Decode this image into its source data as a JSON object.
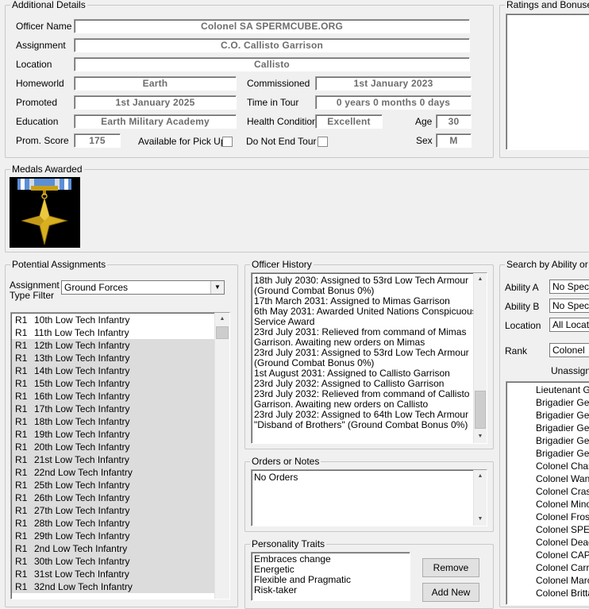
{
  "additional_details": {
    "title": "Additional Details",
    "officer_name_label": "Officer Name",
    "officer_name": "Colonel SA SPERMCUBE.ORG",
    "assignment_label": "Assignment",
    "assignment": "C.O. Callisto Garrison",
    "location_label": "Location",
    "location": "Callisto",
    "homeworld_label": "Homeworld",
    "homeworld": "Earth",
    "commissioned_label": "Commissioned",
    "commissioned": "1st January 2023",
    "promoted_label": "Promoted",
    "promoted": "1st January 2025",
    "time_in_tour_label": "Time in Tour",
    "time_in_tour": "0 years 0 months 0 days",
    "education_label": "Education",
    "education": "Earth Military Academy",
    "health_label": "Health Condition",
    "health": "Excellent",
    "age_label": "Age",
    "age": "30",
    "prom_score_label": "Prom. Score",
    "prom_score": "175",
    "pickup_label": "Available for Pick Up",
    "not_end_tour_label": "Do Not End Tour",
    "sex_label": "Sex",
    "sex": "M"
  },
  "ratings": {
    "title": "Ratings and Bonuses"
  },
  "medals": {
    "title": "Medals Awarded"
  },
  "colors": {
    "ribbon_blue": "#5b8fd6",
    "medal_gold": "#d8b020"
  },
  "potential_assignments": {
    "title": "Potential Assignments",
    "filter_label_1": "Assignment",
    "filter_label_2": "Type Filter",
    "filter_value": "Ground Forces",
    "items": [
      {
        "r": "R1",
        "name": "10th Low Tech Infantry"
      },
      {
        "r": "R1",
        "name": "11th Low Tech Infantry"
      },
      {
        "r": "R1",
        "name": "12th Low Tech Infantry"
      },
      {
        "r": "R1",
        "name": "13th Low Tech Infantry"
      },
      {
        "r": "R1",
        "name": "14th Low Tech Infantry"
      },
      {
        "r": "R1",
        "name": "15th Low Tech Infantry"
      },
      {
        "r": "R1",
        "name": "16th Low Tech Infantry"
      },
      {
        "r": "R1",
        "name": "17th Low Tech Infantry"
      },
      {
        "r": "R1",
        "name": "18th Low Tech Infantry"
      },
      {
        "r": "R1",
        "name": "19th Low Tech Infantry"
      },
      {
        "r": "R1",
        "name": "20th Low Tech Infantry"
      },
      {
        "r": "R1",
        "name": "21st Low Tech Infantry"
      },
      {
        "r": "R1",
        "name": "22nd Low Tech Infantry"
      },
      {
        "r": "R1",
        "name": "25th Low Tech Infantry"
      },
      {
        "r": "R1",
        "name": "26th Low Tech Infantry"
      },
      {
        "r": "R1",
        "name": "27th Low Tech Infantry"
      },
      {
        "r": "R1",
        "name": "28th Low Tech Infantry"
      },
      {
        "r": "R1",
        "name": "29th Low Tech Infantry"
      },
      {
        "r": "R1",
        "name": "2nd Low Tech Infantry"
      },
      {
        "r": "R1",
        "name": "30th Low Tech Infantry"
      },
      {
        "r": "R1",
        "name": "31st Low Tech Infantry"
      },
      {
        "r": "R1",
        "name": "32nd Low Tech Infantry"
      }
    ]
  },
  "officer_history": {
    "title": "Officer History",
    "lines": [
      "18th July 2030: Assigned to 53rd Low Tech Armour",
      "(Ground Combat Bonus 0%)",
      "17th March 2031: Assigned to Mimas Garrison",
      "6th May 2031: Awarded United Nations Conspicuous",
      "Service Award",
      "23rd July 2031: Relieved from command of Mimas",
      "Garrison. Awaiting new orders on Mimas",
      "23rd July 2031: Assigned to 53rd Low Tech Armour",
      "(Ground Combat Bonus 0%)",
      "1st August 2031: Assigned to Callisto Garrison",
      "23rd July 2032: Assigned to Callisto Garrison",
      "23rd July 2032: Relieved from command of Callisto",
      "Garrison. Awaiting new orders on Callisto",
      "23rd July 2032: Assigned to 64th Low Tech Armour",
      "\"Disband of Brothers\" (Ground Combat Bonus 0%)"
    ]
  },
  "orders": {
    "title": "Orders or Notes",
    "text": "No Orders"
  },
  "personality": {
    "title": "Personality Traits",
    "traits": [
      "Embraces change",
      "Energetic",
      "Flexible and Pragmatic",
      "Risk-taker"
    ],
    "remove_label": "Remove",
    "add_label": "Add New"
  },
  "search": {
    "title": "Search by Ability or Lo",
    "ability_a_label": "Ability A",
    "ability_a_value": "No Specif",
    "ability_b_label": "Ability B",
    "ability_b_value": "No Specif",
    "location_label": "Location",
    "location_value": "All Locatio",
    "rank_label": "Rank",
    "rank_value": "Colonel",
    "unassigned_label": "Unassigne",
    "results": [
      "Lieutenant Ge",
      "Brigadier Gene",
      "Brigadier Gene",
      "Brigadier Gene",
      "Brigadier Gene",
      "Brigadier Gene",
      "Colonel Cham",
      "Colonel Wanu",
      "Colonel Crassu",
      "Colonel Minorf",
      "Colonel Froste",
      "Colonel SPER",
      "Colonel Deade",
      "Colonel CAPS",
      "Colonel Carrol",
      "Colonel Marc I",
      "Colonel Britta I"
    ]
  }
}
